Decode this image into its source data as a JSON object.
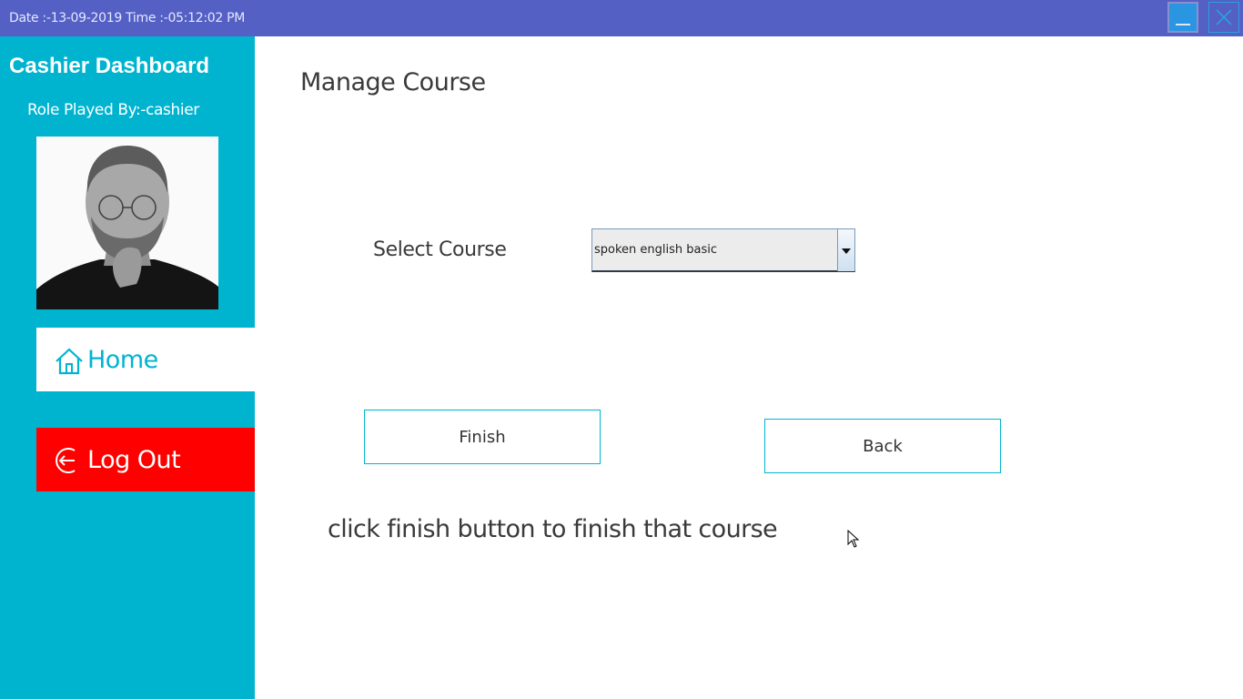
{
  "titlebar": {
    "datetime": "Date :-13-09-2019 Time :-05:12:02 PM",
    "minimize_icon": "minimize-icon",
    "close_icon": "close-icon"
  },
  "sidebar": {
    "title": "Cashier Dashboard",
    "role": "Role Played By:-cashier",
    "items": [
      {
        "label": "Home",
        "icon": "home-icon"
      },
      {
        "label": "Log Out",
        "icon": "logout-icon"
      }
    ]
  },
  "main": {
    "title": "Manage Course",
    "select_label": "Select Course",
    "select_value": "spoken english basic",
    "finish_label": "Finish",
    "back_label": "Back",
    "hint": "click finish button to finish that course"
  },
  "colors": {
    "titlebar": "#5460c4",
    "sidebar": "#00b4d0",
    "logout": "#ff0000",
    "accent": "#00b4d0"
  }
}
